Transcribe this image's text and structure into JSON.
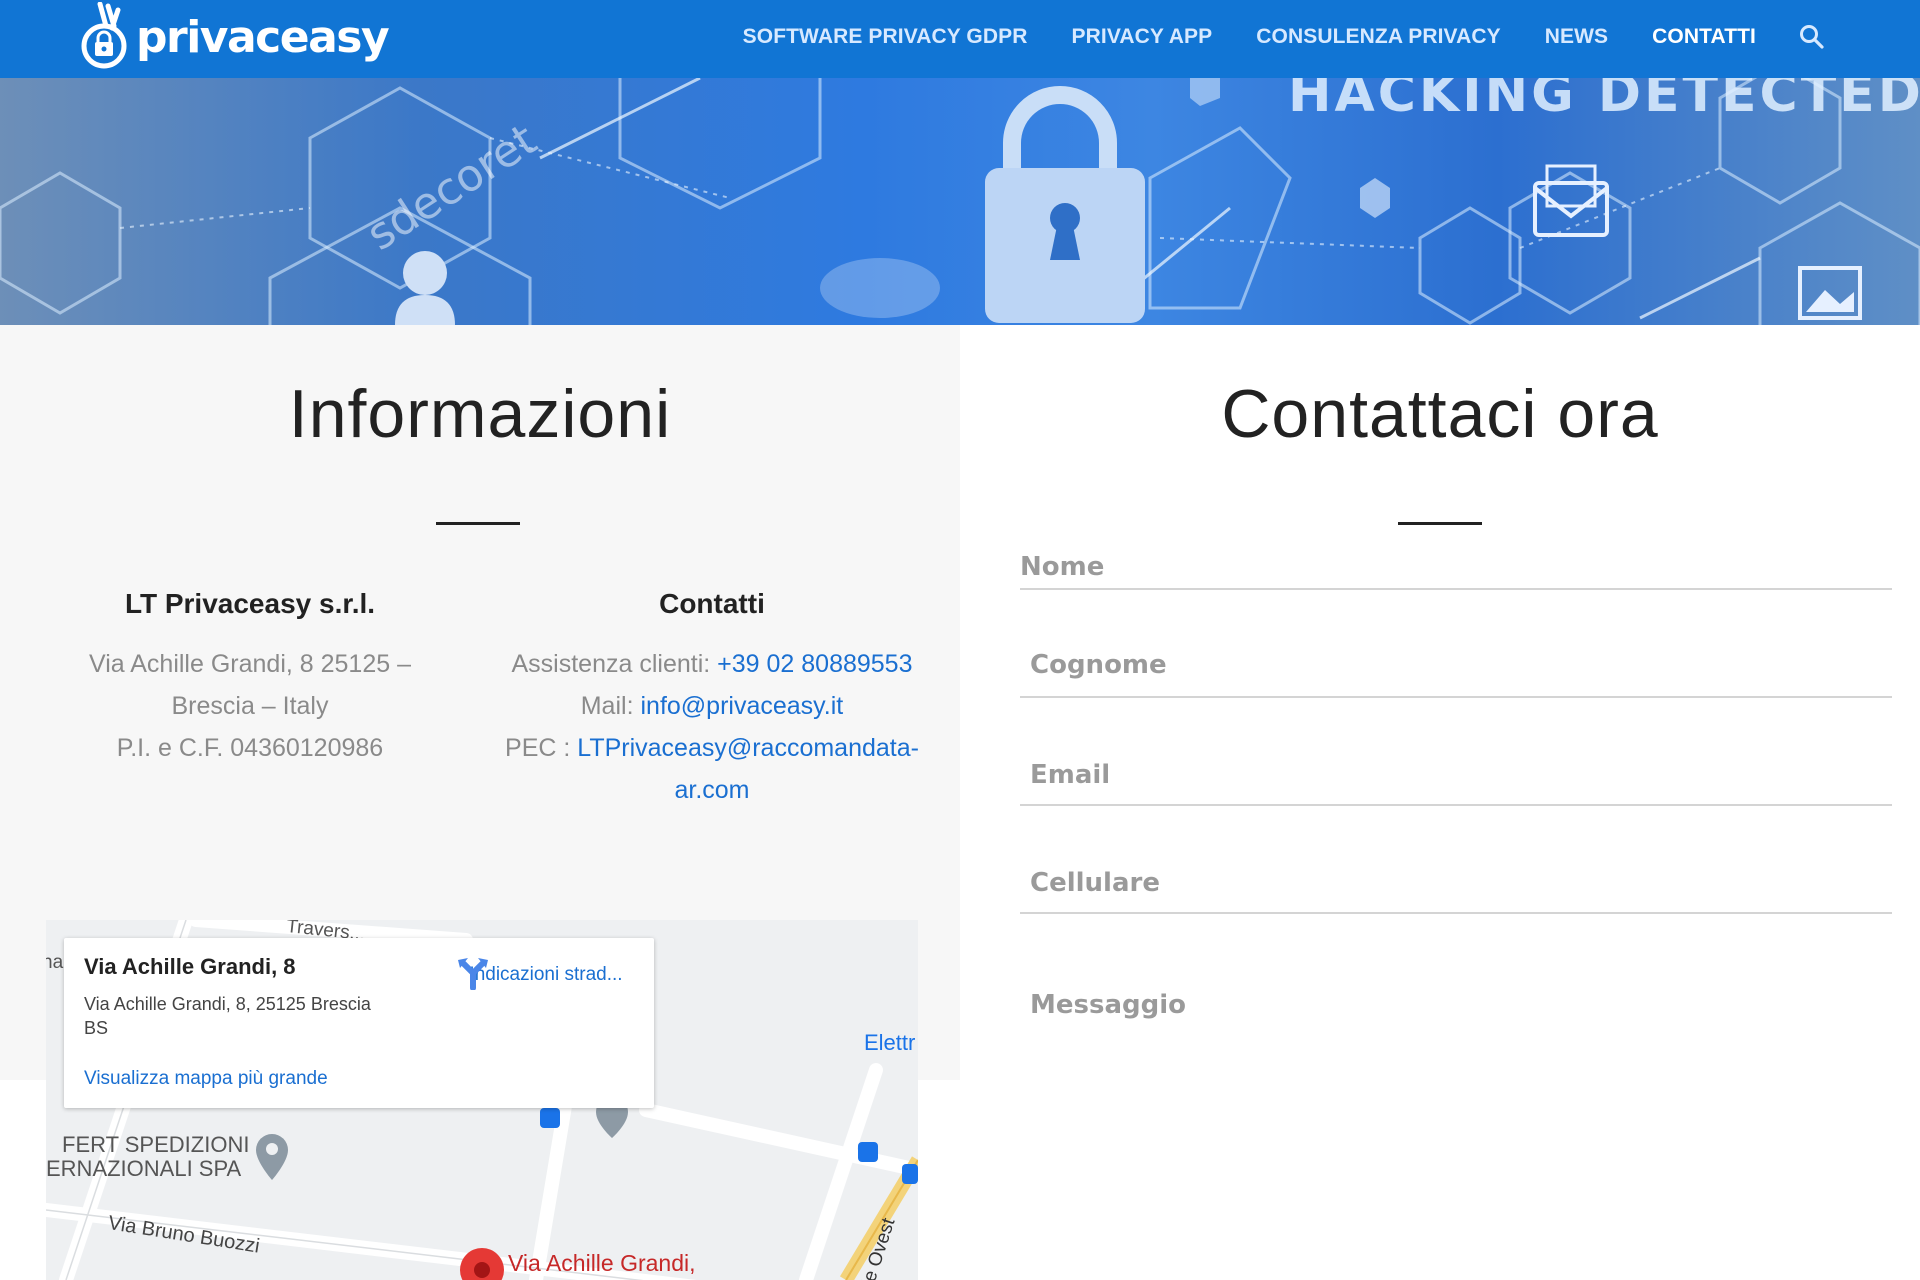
{
  "brand": {
    "name": "privaceasy"
  },
  "nav": {
    "items": [
      {
        "label": "SOFTWARE PRIVACY GDPR",
        "active": false
      },
      {
        "label": "PRIVACY APP",
        "active": false
      },
      {
        "label": "CONSULENZA PRIVACY",
        "active": false
      },
      {
        "label": "NEWS",
        "active": false
      },
      {
        "label": "CONTATTI",
        "active": true
      }
    ],
    "search_icon": "search-icon"
  },
  "hero": {
    "banner_text": "HACKING DETECTED",
    "watermark": "sdecoret"
  },
  "info": {
    "title": "Informazioni",
    "company": {
      "name": "LT Privaceasy s.r.l.",
      "address_line1": "Via Achille Grandi, 8 25125 –",
      "address_line2": "Brescia – Italy",
      "vat": "P.I. e C.F. 04360120986"
    },
    "contacts": {
      "heading": "Contatti",
      "support_label": "Assistenza clienti:",
      "support_phone": "+39 02 80889553",
      "mail_label": "Mail:",
      "mail_value": "info@privaceasy.it",
      "pec_label": "PEC :",
      "pec_value_line1": "LTPrivaceasy@raccomandata-",
      "pec_value_line2": "ar.com"
    }
  },
  "map": {
    "card_title": "Via Achille Grandi, 8",
    "card_address_line1": "Via Achille Grandi, 8, 25125 Brescia",
    "card_address_line2": "BS",
    "directions_label": "Indicazioni strad...",
    "larger_map_label": "Visualizza mappa più grande",
    "labels": {
      "traversa": "Travers...",
      "elettr": "Elettr",
      "fert_line1": "FERT SPEDIZIONI",
      "fert_line2": "ERNAZIONALI SPA",
      "buozzi": "Via Bruno Buozzi",
      "grandi_pin": "Via Achille Grandi,",
      "ovest": "le Ovest",
      "edge_left": "na"
    }
  },
  "form": {
    "title": "Contattaci ora",
    "fields": {
      "nome": "Nome",
      "cognome": "Cognome",
      "email": "Email",
      "cellulare": "Cellulare",
      "messaggio": "Messaggio"
    }
  },
  "colors": {
    "header_bg": "#1175d4",
    "link": "#1a6fd1",
    "text_dark": "#222222",
    "text_muted": "#8a8a8a"
  }
}
